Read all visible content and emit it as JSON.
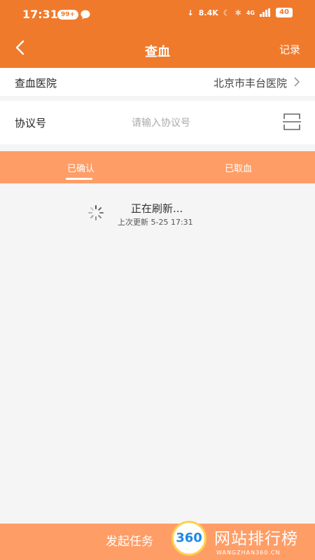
{
  "status_bar": {
    "time": "17:31",
    "notification_badge": "99+",
    "net_speed": "8.4K",
    "network": "4G",
    "battery": "40"
  },
  "header": {
    "title": "查血",
    "right_action": "记录"
  },
  "form": {
    "hospital_label": "查血医院",
    "hospital_value": "北京市丰台医院",
    "protocol_label": "协议号",
    "protocol_placeholder": "请输入协议号",
    "protocol_value": ""
  },
  "tabs": [
    {
      "label": "已确认",
      "active": true
    },
    {
      "label": "已取血",
      "active": false
    }
  ],
  "refresh": {
    "title": "正在刷新...",
    "subtitle": "上次更新 5-25 17:31"
  },
  "footer": {
    "button_label": "发起任务"
  },
  "watermark": {
    "number": "360",
    "text": "网站排行榜",
    "url": "WANGZHAN360.CN"
  },
  "colors": {
    "primary": "#f07a2c",
    "tab_bg": "#ff9d66",
    "page_bg": "#f5f5f5"
  }
}
